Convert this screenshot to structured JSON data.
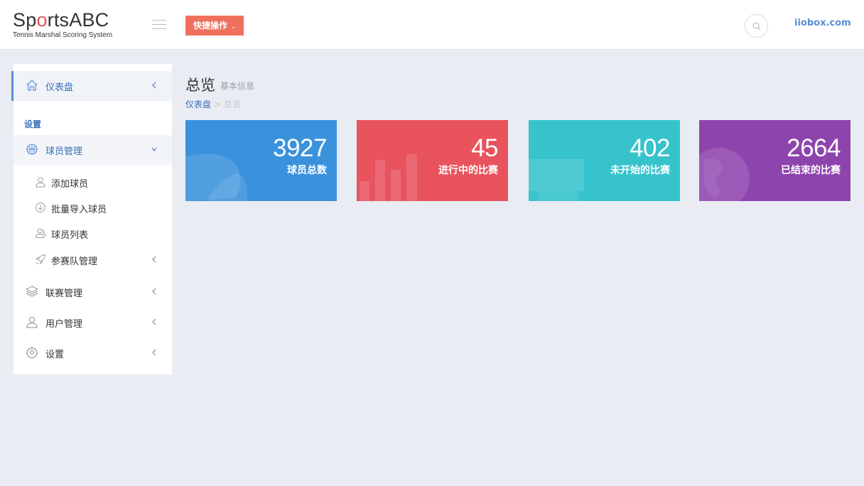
{
  "header": {
    "logo_main_pre": "Sp",
    "logo_main_ball": "o",
    "logo_main_post": "rtsABC",
    "logo_sub": "Tennis Marshal Scoring System",
    "quick_action_label": "快捷操作",
    "site_link": "iiobox.com"
  },
  "sidebar": {
    "dashboard": "仪表盘",
    "section_label": "设置",
    "player_mgmt": "球员管理",
    "sub_items": [
      "添加球员",
      "批量导入球员",
      "球员列表",
      "参赛队管理"
    ],
    "league_mgmt": "联赛管理",
    "user_mgmt": "用户管理",
    "settings": "设置"
  },
  "main": {
    "title": "总览",
    "subtitle": "基本信息",
    "breadcrumb_home": "仪表盘",
    "breadcrumb_sep": ">",
    "breadcrumb_current": "总览",
    "cards": [
      {
        "value": "3927",
        "label": "球员总数",
        "color": "#3b92dc"
      },
      {
        "value": "45",
        "label": "进行中的比赛",
        "color": "#e8535d"
      },
      {
        "value": "402",
        "label": "未开始的比赛",
        "color": "#37c3cc"
      },
      {
        "value": "2664",
        "label": "已结束的比赛",
        "color": "#8e44ad"
      }
    ]
  },
  "icons": [
    "menu-icon",
    "search-icon",
    "home-icon",
    "basketball-icon",
    "user-icon",
    "download-circle-icon",
    "users-icon",
    "rocket-icon",
    "layers-icon",
    "gear-icon",
    "chevron-left-icon",
    "chevron-down-icon",
    "chat-bubble-icon",
    "bar-chart-icon",
    "laptop-icon",
    "globe-icon"
  ]
}
